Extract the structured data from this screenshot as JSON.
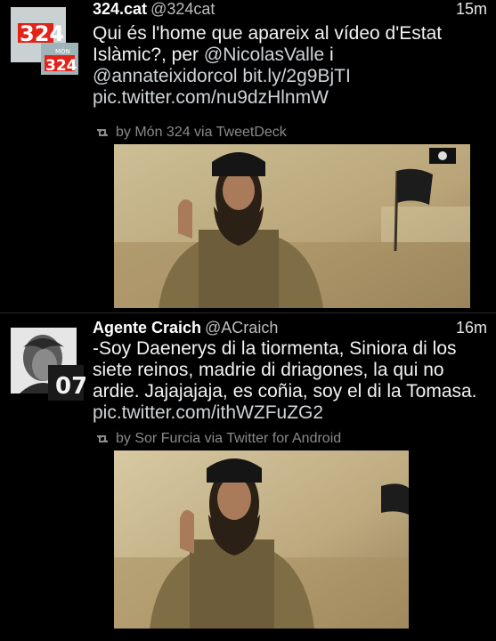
{
  "tweets": [
    {
      "author_name": "324.cat",
      "handle": "@324cat",
      "time": "15m",
      "text_plain": "Qui és l'home que apareix al vídeo d'Estat Islàmic?, per ",
      "mention1": "@NicolasValle",
      "text_mid": " i ",
      "mention2": "@annateixidorcol",
      "link1": " bit.ly/2g9BjTI",
      "link2": "pic.twitter.com/nu9dzHlnmW",
      "via": "by Món 324 via TweetDeck",
      "avatar_label_top": "324",
      "avatar_label_small": "MÓN",
      "avatar_label_bottom": "324"
    },
    {
      "author_name": "Agente Craich",
      "handle": "@ACraich",
      "time": "16m",
      "text_plain": "-Soy Daenerys di la tiormenta, Siniora di los siete reinos, madrie di driagones, la qui no ardie. Jajajajaja, es coñia, soy el di la Tomasa. ",
      "link1": "pic.twitter.com/ithWZFuZG2",
      "via": "by Sor Furcia via Twitter for Android",
      "avatar_label": "07"
    }
  ],
  "colors": {
    "background": "#000000",
    "link": "#cfd4d8",
    "meta": "#8a8a8a",
    "brand_red": "#e2231a"
  },
  "icons": [
    "retweet-icon",
    "flag-icon"
  ]
}
